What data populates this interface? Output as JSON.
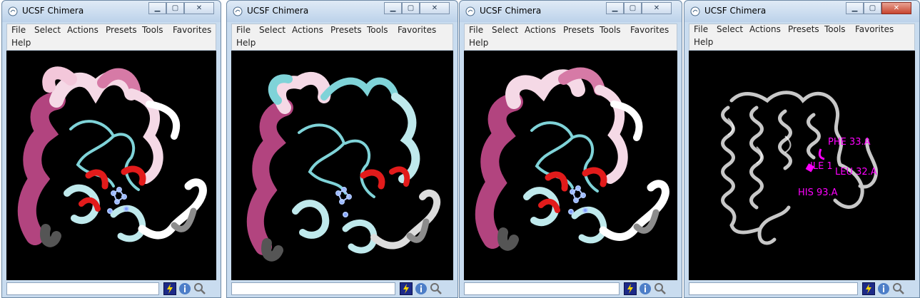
{
  "app_title": "UCSF Chimera",
  "menu": [
    "File",
    "Select",
    "Actions",
    "Presets",
    "Tools",
    "Favorites",
    "Help"
  ],
  "window_controls": {
    "minimize": "minimize-icon",
    "maximize": "maximize-icon",
    "close": "close-icon"
  },
  "windows": [
    {
      "id": "w1",
      "title": "UCSF Chimera",
      "command": "",
      "view": "ribbon-worm-colored"
    },
    {
      "id": "w2",
      "title": "UCSF Chimera",
      "command": "",
      "view": "ribbon-worm-colored"
    },
    {
      "id": "w3",
      "title": "UCSF Chimera",
      "command": "",
      "view": "ribbon-worm-colored"
    },
    {
      "id": "w4",
      "title": "UCSF Chimera",
      "command": "",
      "view": "ribbon-gray-labeled"
    }
  ],
  "residue_labels": [
    "PHE 33.A",
    "ILE 1",
    "LEU 32.A",
    "HIS 93.A"
  ],
  "status_icons": [
    "command-bolt-icon",
    "info-icon",
    "magnifier-icon"
  ],
  "colors": {
    "viewport_bg": "#000000",
    "worm_pink_dark": "#b2447f",
    "worm_pink_light": "#f5d9e6",
    "worm_cyan": "#7fd3d8",
    "heme_red": "#e21b1b",
    "label_magenta": "#ff00ff",
    "ribbon_gray": "#c8c8c8"
  }
}
